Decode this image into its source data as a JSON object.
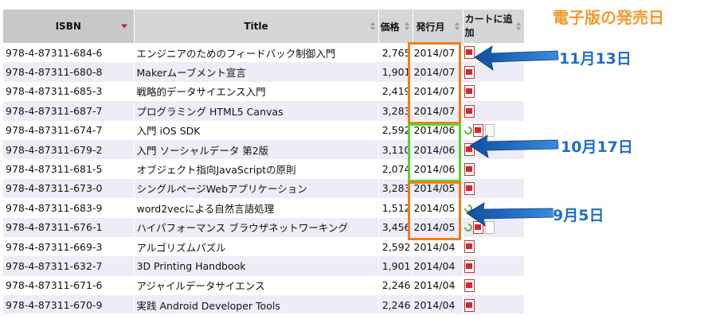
{
  "headers": {
    "isbn": "ISBN",
    "title": "Title",
    "price": "価格",
    "date": "発行月",
    "cart": "カートに追加"
  },
  "rows": [
    {
      "isbn": "978-4-87311-684-6",
      "title": "エンジニアのためのフィードバック制御入門",
      "price": "2,765",
      "date": "2014/07",
      "formats": [
        "pdf"
      ]
    },
    {
      "isbn": "978-4-87311-680-8",
      "title": "Makerムーブメント宣言",
      "price": "1,901",
      "date": "2014/07",
      "formats": [
        "pdf"
      ]
    },
    {
      "isbn": "978-4-87311-685-3",
      "title": "戦略的データサイエンス入門",
      "price": "2,419",
      "date": "2014/07",
      "formats": [
        "pdf"
      ]
    },
    {
      "isbn": "978-4-87311-687-7",
      "title": "プログラミング HTML5 Canvas",
      "price": "3,283",
      "date": "2014/07",
      "formats": [
        "pdf"
      ]
    },
    {
      "isbn": "978-4-87311-674-7",
      "title": "入門 iOS SDK",
      "price": "2,592",
      "date": "2014/06",
      "formats": [
        "epub",
        "pdf",
        "file"
      ]
    },
    {
      "isbn": "978-4-87311-679-2",
      "title": "入門 ソーシャルデータ 第2版",
      "price": "3,110",
      "date": "2014/06",
      "formats": [
        "pdf"
      ]
    },
    {
      "isbn": "978-4-87311-681-5",
      "title": "オブジェクト指向JavaScriptの原則",
      "price": "2,074",
      "date": "2014/06",
      "formats": [
        "pdf"
      ]
    },
    {
      "isbn": "978-4-87311-673-0",
      "title": "シングルページWebアプリケーション",
      "price": "3,283",
      "date": "2014/05",
      "formats": [
        "pdf"
      ]
    },
    {
      "isbn": "978-4-87311-683-9",
      "title": "word2vecによる自然言語処理",
      "price": "1,512",
      "date": "2014/05",
      "formats": [
        "epub"
      ]
    },
    {
      "isbn": "978-4-87311-676-1",
      "title": "ハイパフォーマンス ブラウザネットワーキング",
      "price": "3,456",
      "date": "2014/05",
      "formats": [
        "epub",
        "pdf",
        "file"
      ]
    },
    {
      "isbn": "978-4-87311-669-3",
      "title": "アルゴリズムパズル",
      "price": "2,592",
      "date": "2014/04",
      "formats": [
        "pdf"
      ]
    },
    {
      "isbn": "978-4-87311-632-7",
      "title": "3D Printing Handbook",
      "price": "1,901",
      "date": "2014/04",
      "formats": [
        "pdf"
      ]
    },
    {
      "isbn": "978-4-87311-671-6",
      "title": "アジャイルデータサイエンス",
      "price": "2,246",
      "date": "2014/04",
      "formats": [
        "pdf"
      ]
    },
    {
      "isbn": "978-4-87311-670-9",
      "title": "実践 Android Developer Tools",
      "price": "2,246",
      "date": "2014/04",
      "formats": [
        "pdf"
      ]
    }
  ],
  "annotations": {
    "heading": "電子版の発売日",
    "callout_jul": "11月13日",
    "callout_jun": "10月17日",
    "callout_may": "9月5日"
  },
  "colors": {
    "orange": "#f07c1a",
    "green": "#5bd12b",
    "arrow": "#1f6fc6",
    "heading": "#f39a2c"
  }
}
